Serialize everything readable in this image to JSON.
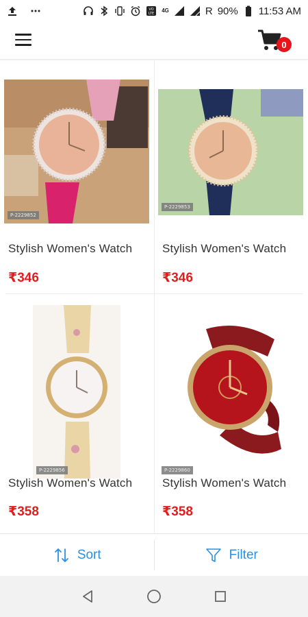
{
  "status_bar": {
    "time": "11:53 AM",
    "battery": "90%",
    "roaming": "R",
    "network": "4G",
    "volte": "VO LTE",
    "icons": [
      "upload-icon",
      "more-icon",
      "headphones-icon",
      "bluetooth-icon",
      "vibrate-icon",
      "alarm-icon",
      "volte-icon",
      "signal-icon",
      "signal-icon",
      "battery-icon"
    ]
  },
  "app_bar": {
    "menu_icon": "hamburger-menu-icon",
    "cart_icon": "cart-icon",
    "cart_count": "0"
  },
  "products": [
    {
      "name": "Stylish Women's Watch",
      "price": "₹346",
      "code": "P-2229852",
      "image": "rose-gold watch with pink floral strap"
    },
    {
      "name": "Stylish Women's Watch",
      "price": "₹346",
      "code": "P-2229853",
      "image": "gold watch with navy floral strap"
    },
    {
      "name": "Stylish Women's Watch",
      "price": "₹358",
      "code": "P-2229856",
      "image": "white dial watch with floral ceramic strap"
    },
    {
      "name": "Stylish Women's Watch",
      "price": "₹358",
      "code": "P-2229860",
      "image": "red leather strap watch with red dial"
    }
  ],
  "actions": {
    "sort_label": "Sort",
    "filter_label": "Filter"
  },
  "colors": {
    "accent": "#2a8fe0",
    "price": "#e01e1e",
    "badge": "#e8141c"
  }
}
